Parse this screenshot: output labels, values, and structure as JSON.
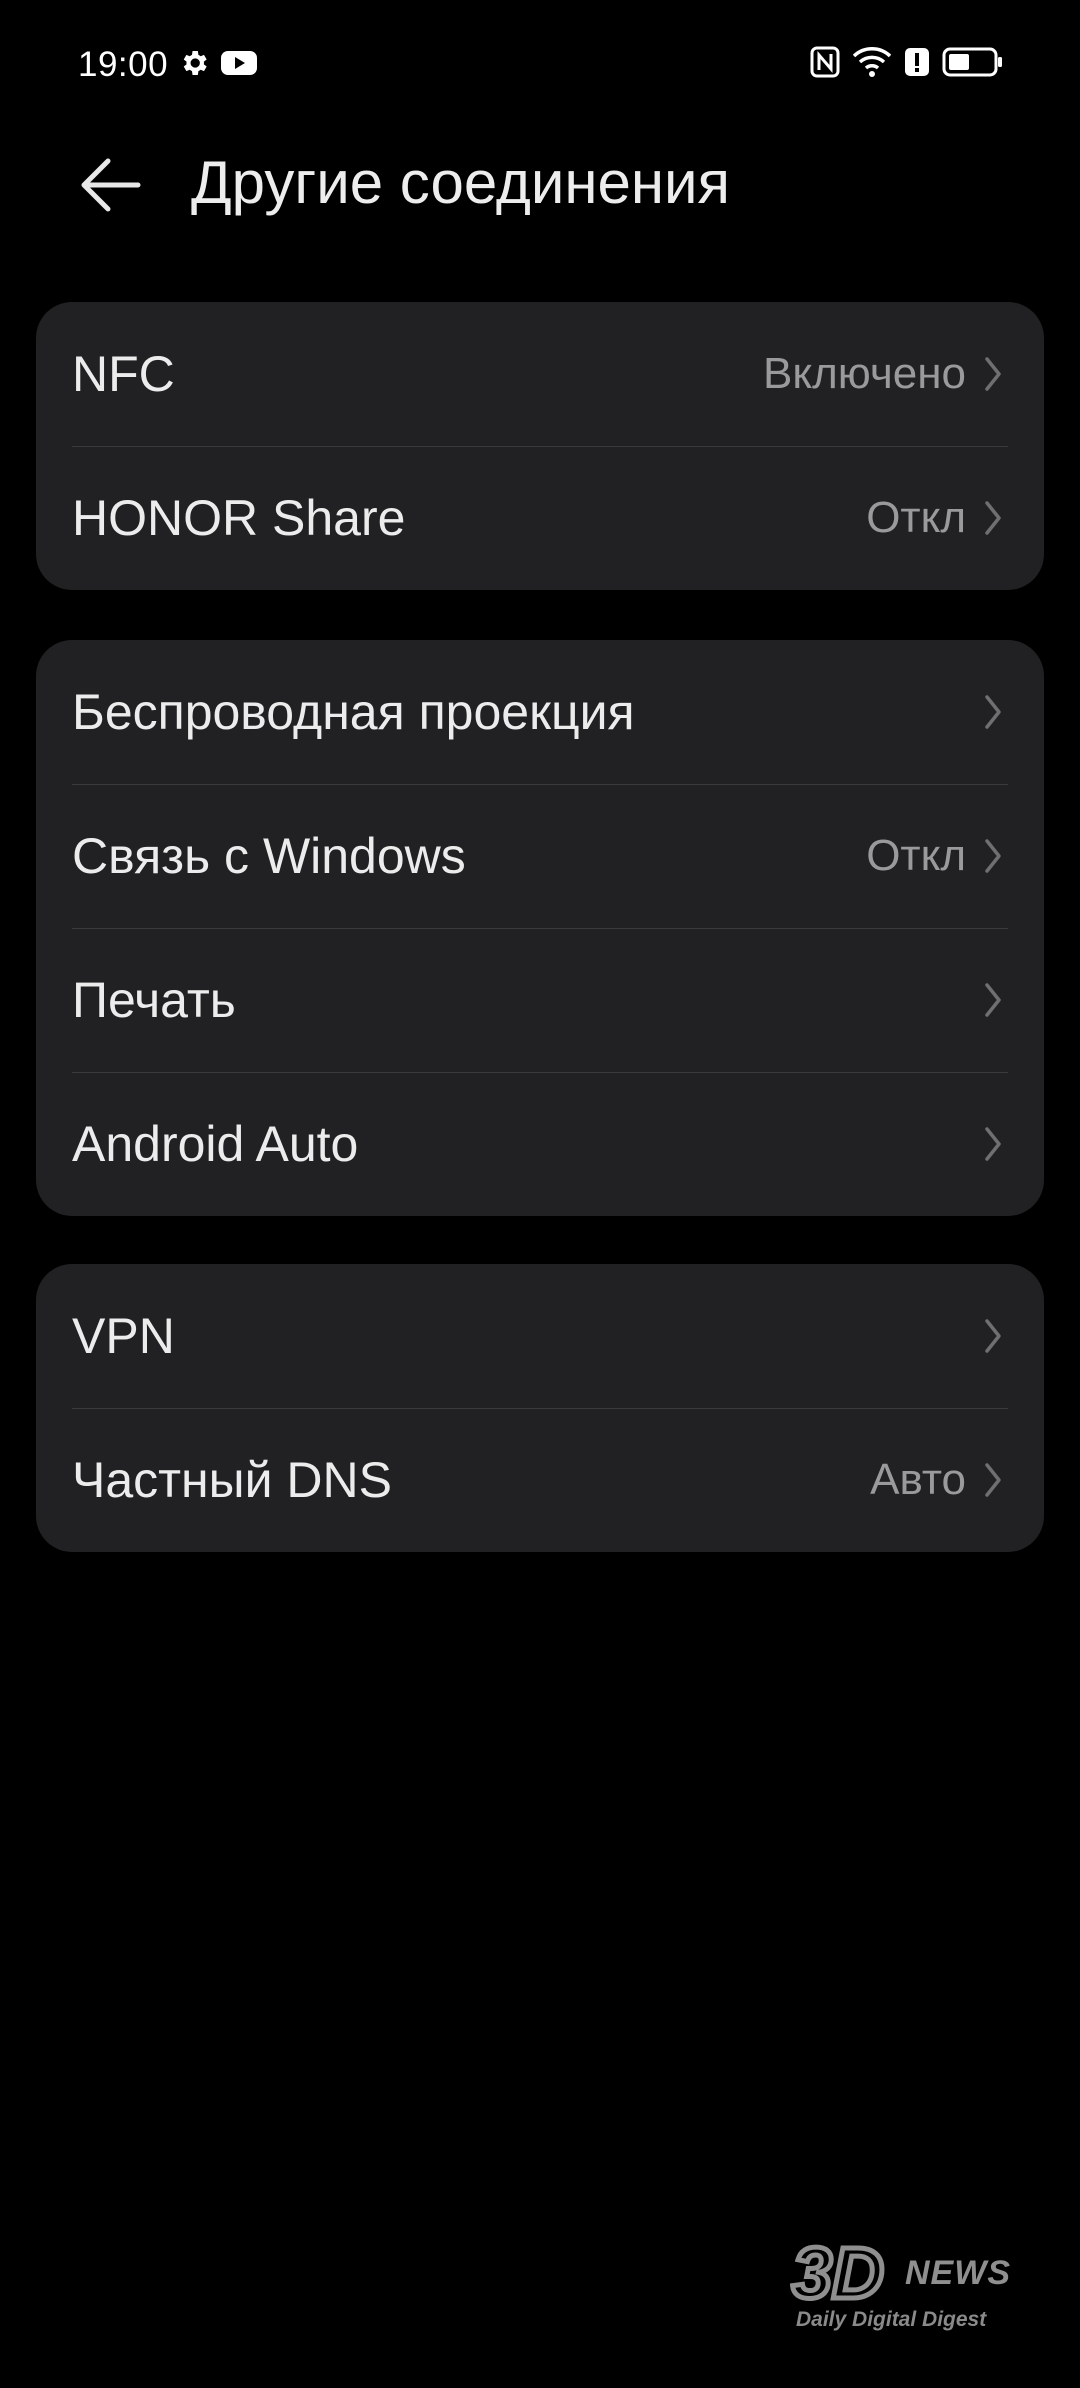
{
  "status_bar": {
    "time": "19:00",
    "left_icons": [
      "gear-icon",
      "youtube-icon"
    ],
    "right_icons": [
      "nfc-icon",
      "wifi-icon",
      "alert-icon",
      "battery-icon"
    ]
  },
  "header": {
    "title": "Другие соединения",
    "back_icon": "arrow-left-icon"
  },
  "groups": [
    {
      "items": [
        {
          "label": "NFC",
          "value": "Включено"
        },
        {
          "label": "HONOR Share",
          "value": "Откл"
        }
      ]
    },
    {
      "items": [
        {
          "label": "Беспроводная проекция",
          "value": ""
        },
        {
          "label": "Связь с Windows",
          "value": "Откл"
        },
        {
          "label": "Печать",
          "value": ""
        },
        {
          "label": "Android Auto",
          "value": ""
        }
      ]
    },
    {
      "items": [
        {
          "label": "VPN",
          "value": ""
        },
        {
          "label": "Частный DNS",
          "value": "Авто"
        }
      ]
    }
  ],
  "watermark": {
    "brand": "NEWS",
    "tagline": "Daily Digital Digest"
  },
  "colors": {
    "background": "#000000",
    "card": "#212123",
    "text_primary": "#ececec",
    "text_secondary": "#9a9a9c",
    "divider": "#3a3a3c"
  }
}
